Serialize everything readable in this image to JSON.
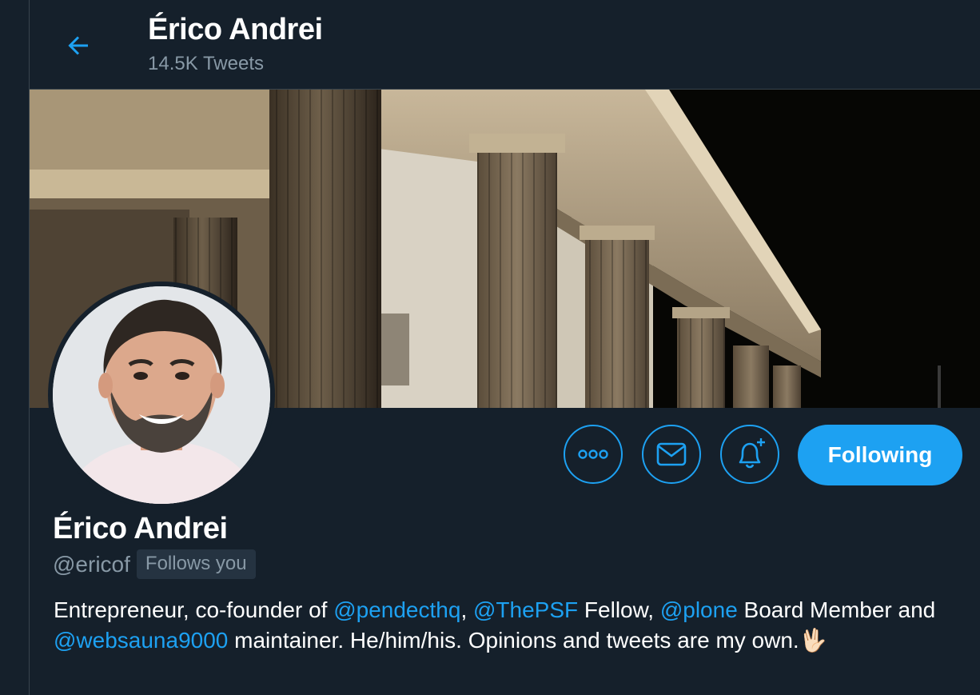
{
  "header": {
    "title": "Érico Andrei",
    "tweet_count": "14.5K Tweets",
    "back_icon": "arrow-left-icon"
  },
  "profile": {
    "name": "Érico Andrei",
    "handle": "@ericof",
    "follows_you_badge": "Follows you",
    "bio": {
      "p1": "Entrepreneur, co-founder of ",
      "m1": "@pendecthq",
      "p2": ", ",
      "m2": "@ThePSF",
      "p3": " Fellow, ",
      "m3": "@plone",
      "p4": " Board Member and ",
      "m4": "@websauna9000",
      "p5": " maintainer. He/him/his. Opinions and tweets are my own.",
      "emoji": "🖖🏻"
    }
  },
  "actions": {
    "more_icon": "more-horizontal-icon",
    "message_icon": "envelope-icon",
    "notify_icon": "bell-plus-icon",
    "following_label": "Following"
  },
  "colors": {
    "background": "#15202b",
    "accent": "#1da1f2",
    "secondary_text": "#8899a6",
    "border": "#38444d"
  }
}
